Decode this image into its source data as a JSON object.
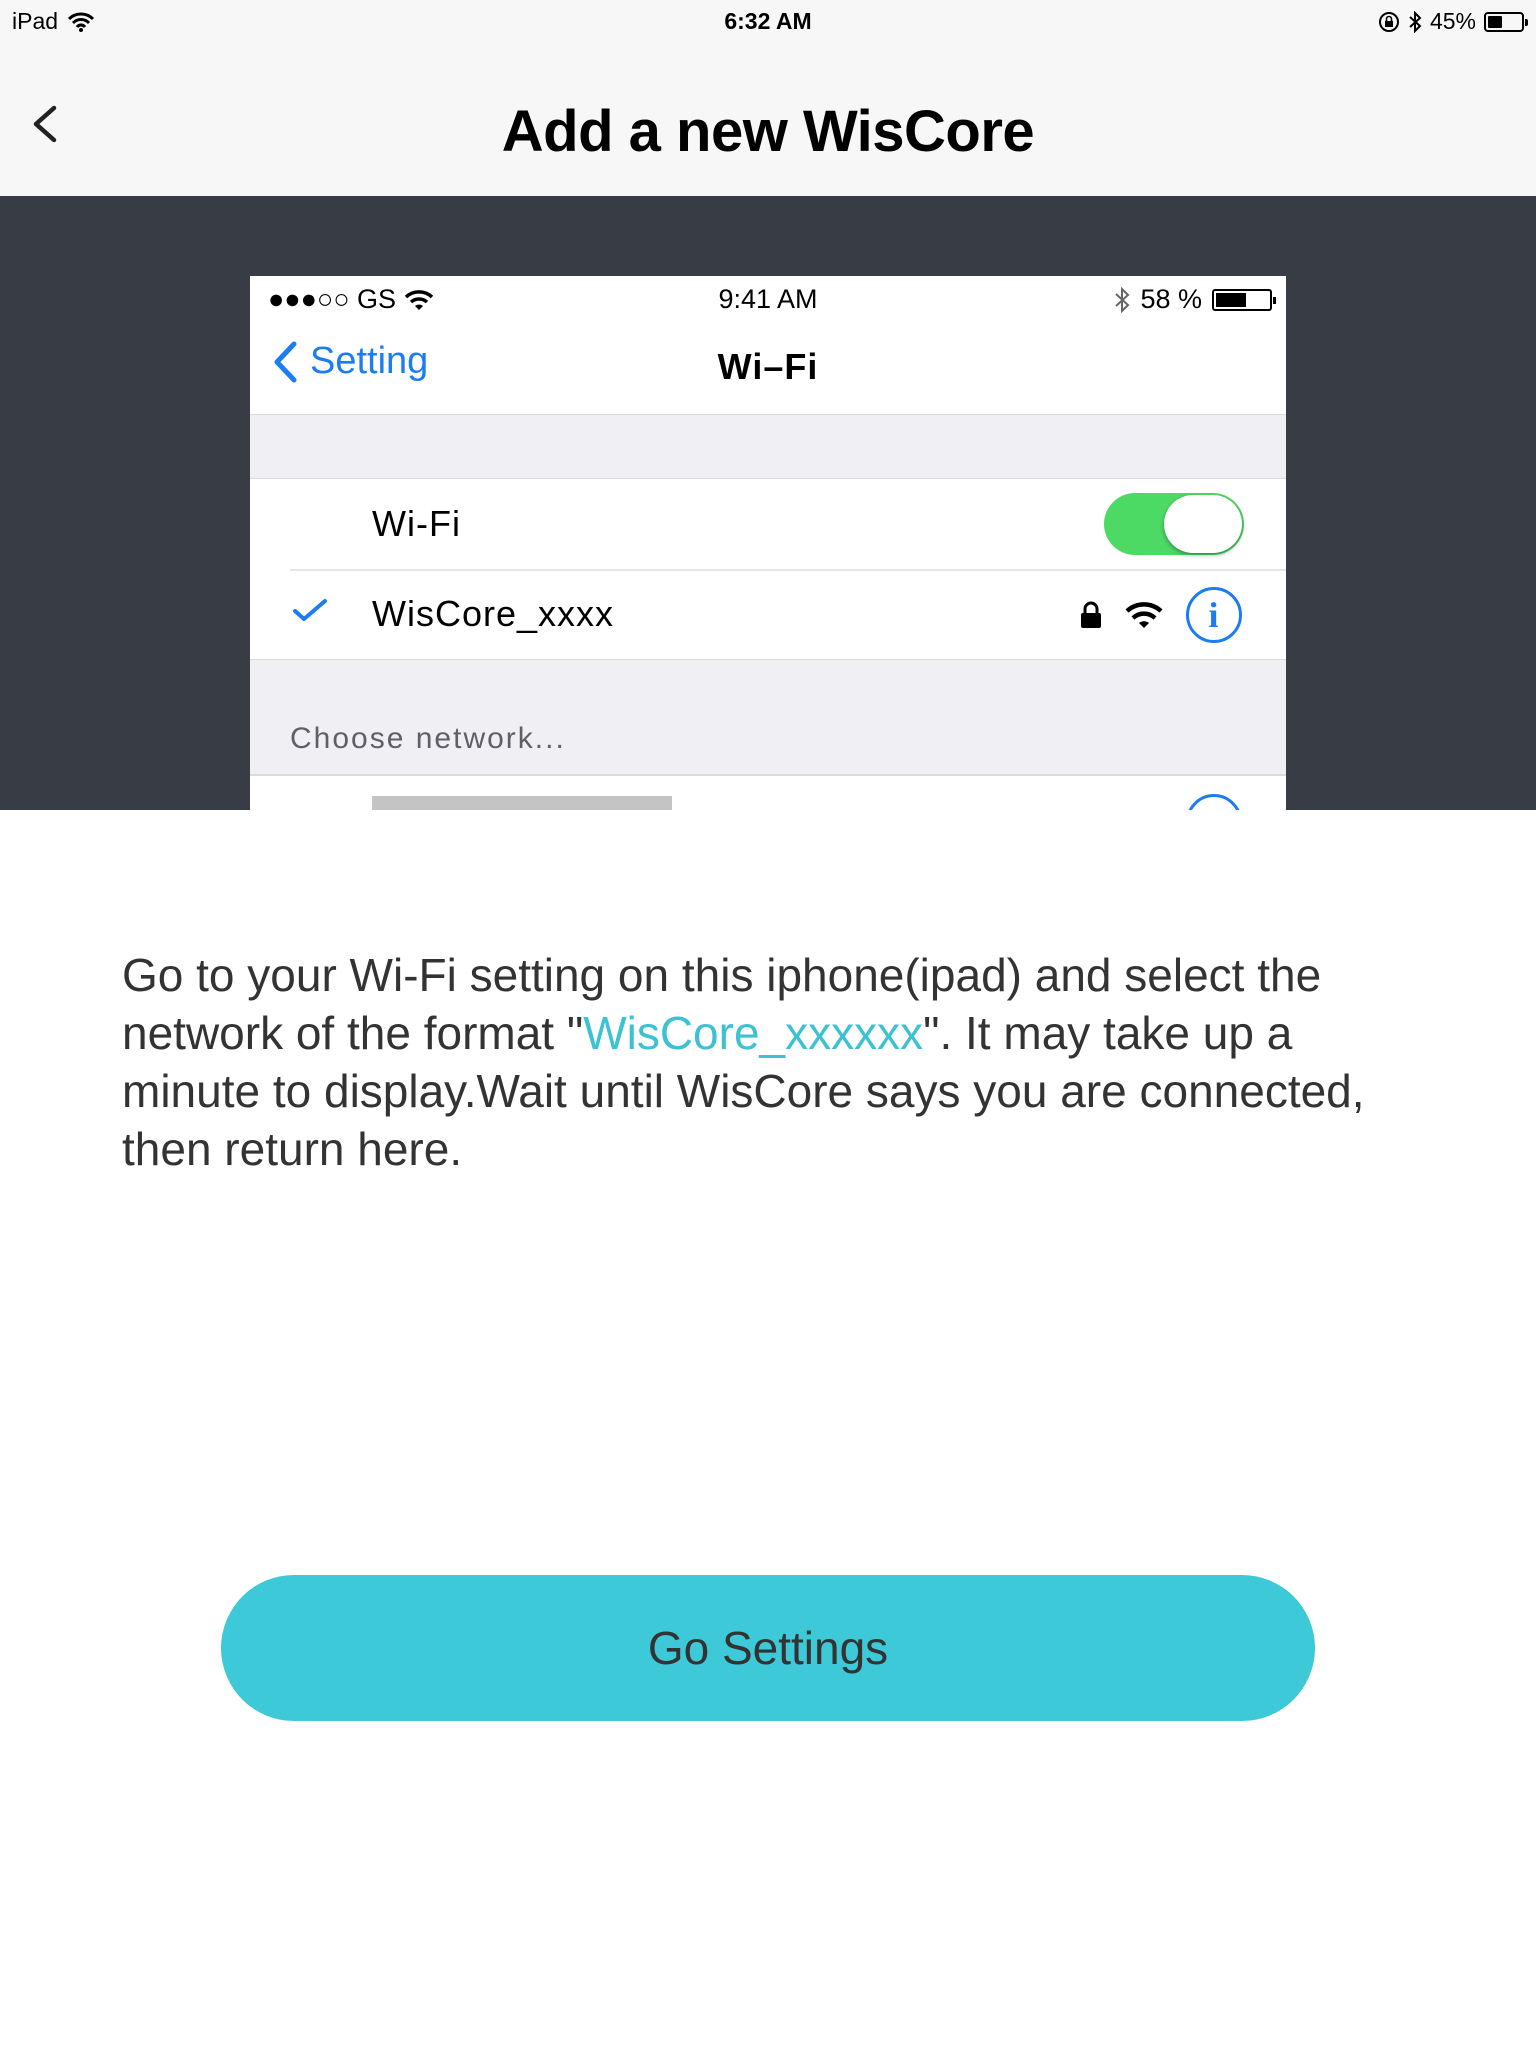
{
  "status_bar": {
    "device": "iPad",
    "time": "6:32 AM",
    "battery": "45%",
    "battery_level": 0.45,
    "icons": [
      "wifi-icon",
      "orientation-lock-icon",
      "bluetooth-icon",
      "battery-icon"
    ]
  },
  "nav": {
    "title": "Add a new WisCore",
    "back_icon": "chevron-left-icon"
  },
  "illustration": {
    "status": {
      "carrier": "●●●○○ GS",
      "time": "9:41 AM",
      "battery": "58 %",
      "battery_level": 0.58
    },
    "nav": {
      "back_label": "Setting",
      "title": "Wi–Fi"
    },
    "rows": {
      "wifi_label": "Wi-Fi",
      "wifi_enabled": true,
      "network_name": "WisCore_xxxx",
      "info_glyph": "i"
    },
    "section_header": "Choose network..."
  },
  "instructions": {
    "before": "Go to your Wi-Fi setting on this iphone(ipad) and select the network of the format \"",
    "highlight": "WisCore_xxxxxx",
    "after": "\". It may take up a minute to display.Wait until WisCore says you are connected, then return here."
  },
  "cta": {
    "label": "Go Settings"
  },
  "colors": {
    "accent": "#3ec9d8",
    "highlight_text": "#3cc2d3",
    "hero_background": "#373c45",
    "ios_blue": "#1c7cf2",
    "toggle_on": "#4cd964"
  }
}
